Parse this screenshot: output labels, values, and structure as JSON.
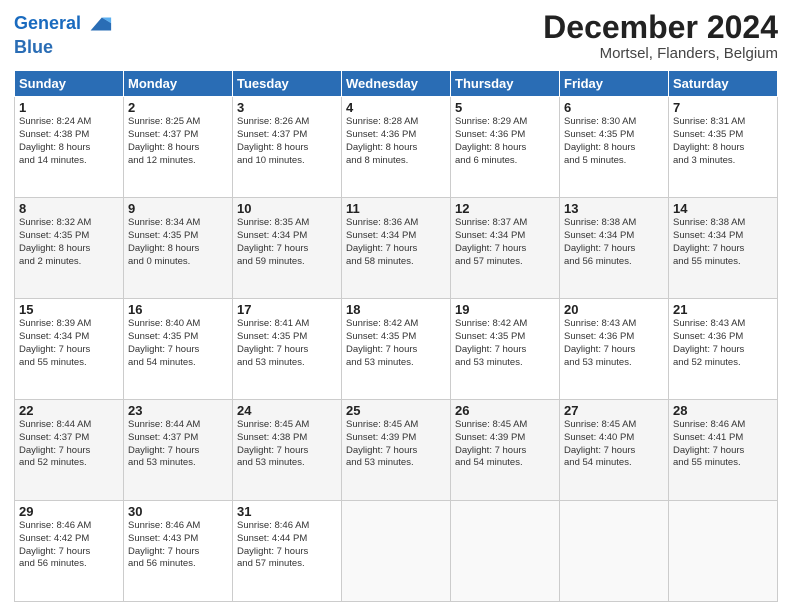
{
  "header": {
    "logo_line1": "General",
    "logo_line2": "Blue",
    "title": "December 2024",
    "subtitle": "Mortsel, Flanders, Belgium"
  },
  "weekdays": [
    "Sunday",
    "Monday",
    "Tuesday",
    "Wednesday",
    "Thursday",
    "Friday",
    "Saturday"
  ],
  "weeks": [
    [
      {
        "day": 1,
        "info": "Sunrise: 8:24 AM\nSunset: 4:38 PM\nDaylight: 8 hours\nand 14 minutes."
      },
      {
        "day": 2,
        "info": "Sunrise: 8:25 AM\nSunset: 4:37 PM\nDaylight: 8 hours\nand 12 minutes."
      },
      {
        "day": 3,
        "info": "Sunrise: 8:26 AM\nSunset: 4:37 PM\nDaylight: 8 hours\nand 10 minutes."
      },
      {
        "day": 4,
        "info": "Sunrise: 8:28 AM\nSunset: 4:36 PM\nDaylight: 8 hours\nand 8 minutes."
      },
      {
        "day": 5,
        "info": "Sunrise: 8:29 AM\nSunset: 4:36 PM\nDaylight: 8 hours\nand 6 minutes."
      },
      {
        "day": 6,
        "info": "Sunrise: 8:30 AM\nSunset: 4:35 PM\nDaylight: 8 hours\nand 5 minutes."
      },
      {
        "day": 7,
        "info": "Sunrise: 8:31 AM\nSunset: 4:35 PM\nDaylight: 8 hours\nand 3 minutes."
      }
    ],
    [
      {
        "day": 8,
        "info": "Sunrise: 8:32 AM\nSunset: 4:35 PM\nDaylight: 8 hours\nand 2 minutes."
      },
      {
        "day": 9,
        "info": "Sunrise: 8:34 AM\nSunset: 4:35 PM\nDaylight: 8 hours\nand 0 minutes."
      },
      {
        "day": 10,
        "info": "Sunrise: 8:35 AM\nSunset: 4:34 PM\nDaylight: 7 hours\nand 59 minutes."
      },
      {
        "day": 11,
        "info": "Sunrise: 8:36 AM\nSunset: 4:34 PM\nDaylight: 7 hours\nand 58 minutes."
      },
      {
        "day": 12,
        "info": "Sunrise: 8:37 AM\nSunset: 4:34 PM\nDaylight: 7 hours\nand 57 minutes."
      },
      {
        "day": 13,
        "info": "Sunrise: 8:38 AM\nSunset: 4:34 PM\nDaylight: 7 hours\nand 56 minutes."
      },
      {
        "day": 14,
        "info": "Sunrise: 8:38 AM\nSunset: 4:34 PM\nDaylight: 7 hours\nand 55 minutes."
      }
    ],
    [
      {
        "day": 15,
        "info": "Sunrise: 8:39 AM\nSunset: 4:34 PM\nDaylight: 7 hours\nand 55 minutes."
      },
      {
        "day": 16,
        "info": "Sunrise: 8:40 AM\nSunset: 4:35 PM\nDaylight: 7 hours\nand 54 minutes."
      },
      {
        "day": 17,
        "info": "Sunrise: 8:41 AM\nSunset: 4:35 PM\nDaylight: 7 hours\nand 53 minutes."
      },
      {
        "day": 18,
        "info": "Sunrise: 8:42 AM\nSunset: 4:35 PM\nDaylight: 7 hours\nand 53 minutes."
      },
      {
        "day": 19,
        "info": "Sunrise: 8:42 AM\nSunset: 4:35 PM\nDaylight: 7 hours\nand 53 minutes."
      },
      {
        "day": 20,
        "info": "Sunrise: 8:43 AM\nSunset: 4:36 PM\nDaylight: 7 hours\nand 53 minutes."
      },
      {
        "day": 21,
        "info": "Sunrise: 8:43 AM\nSunset: 4:36 PM\nDaylight: 7 hours\nand 52 minutes."
      }
    ],
    [
      {
        "day": 22,
        "info": "Sunrise: 8:44 AM\nSunset: 4:37 PM\nDaylight: 7 hours\nand 52 minutes."
      },
      {
        "day": 23,
        "info": "Sunrise: 8:44 AM\nSunset: 4:37 PM\nDaylight: 7 hours\nand 53 minutes."
      },
      {
        "day": 24,
        "info": "Sunrise: 8:45 AM\nSunset: 4:38 PM\nDaylight: 7 hours\nand 53 minutes."
      },
      {
        "day": 25,
        "info": "Sunrise: 8:45 AM\nSunset: 4:39 PM\nDaylight: 7 hours\nand 53 minutes."
      },
      {
        "day": 26,
        "info": "Sunrise: 8:45 AM\nSunset: 4:39 PM\nDaylight: 7 hours\nand 54 minutes."
      },
      {
        "day": 27,
        "info": "Sunrise: 8:45 AM\nSunset: 4:40 PM\nDaylight: 7 hours\nand 54 minutes."
      },
      {
        "day": 28,
        "info": "Sunrise: 8:46 AM\nSunset: 4:41 PM\nDaylight: 7 hours\nand 55 minutes."
      }
    ],
    [
      {
        "day": 29,
        "info": "Sunrise: 8:46 AM\nSunset: 4:42 PM\nDaylight: 7 hours\nand 56 minutes."
      },
      {
        "day": 30,
        "info": "Sunrise: 8:46 AM\nSunset: 4:43 PM\nDaylight: 7 hours\nand 56 minutes."
      },
      {
        "day": 31,
        "info": "Sunrise: 8:46 AM\nSunset: 4:44 PM\nDaylight: 7 hours\nand 57 minutes."
      },
      null,
      null,
      null,
      null
    ]
  ]
}
